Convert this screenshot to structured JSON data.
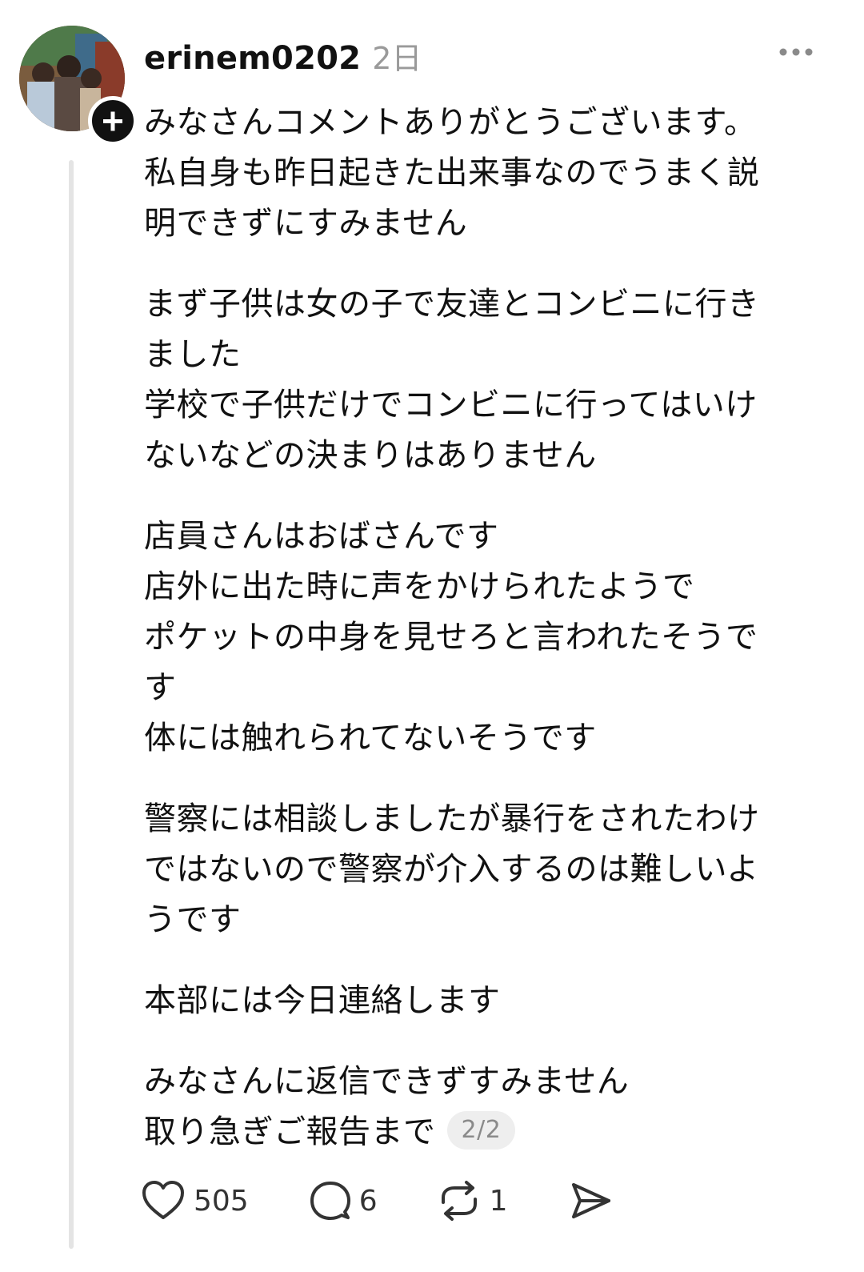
{
  "post": {
    "username": "erinem0202",
    "time": "2日",
    "paragraphs": [
      [
        "みなさんコメントありがとうございます。",
        "私自身も昨日起きた出来事なのでうまく説",
        "明できずにすみません"
      ],
      [
        "まず子供は女の子で友達とコンビニに行き",
        "ました",
        "学校で子供だけでコンビニに行ってはいけ",
        "ないなどの決まりはありません"
      ],
      [
        "店員さんはおばさんです",
        "店外に出た時に声をかけられたようで",
        "ポケットの中身を見せろと言われたそうで",
        "す",
        "体には触れられてないそうです"
      ],
      [
        "警察には相談しましたが暴行をされたわけ",
        "ではないので警察が介入するのは難しいよ",
        "うです"
      ],
      [
        "本部には今日連絡します"
      ],
      [
        "みなさんに返信できずすみません",
        "取り急ぎご報告まで"
      ]
    ],
    "page_badge": "2/2"
  },
  "actions": {
    "likes": "505",
    "replies": "6",
    "reposts": "1"
  }
}
